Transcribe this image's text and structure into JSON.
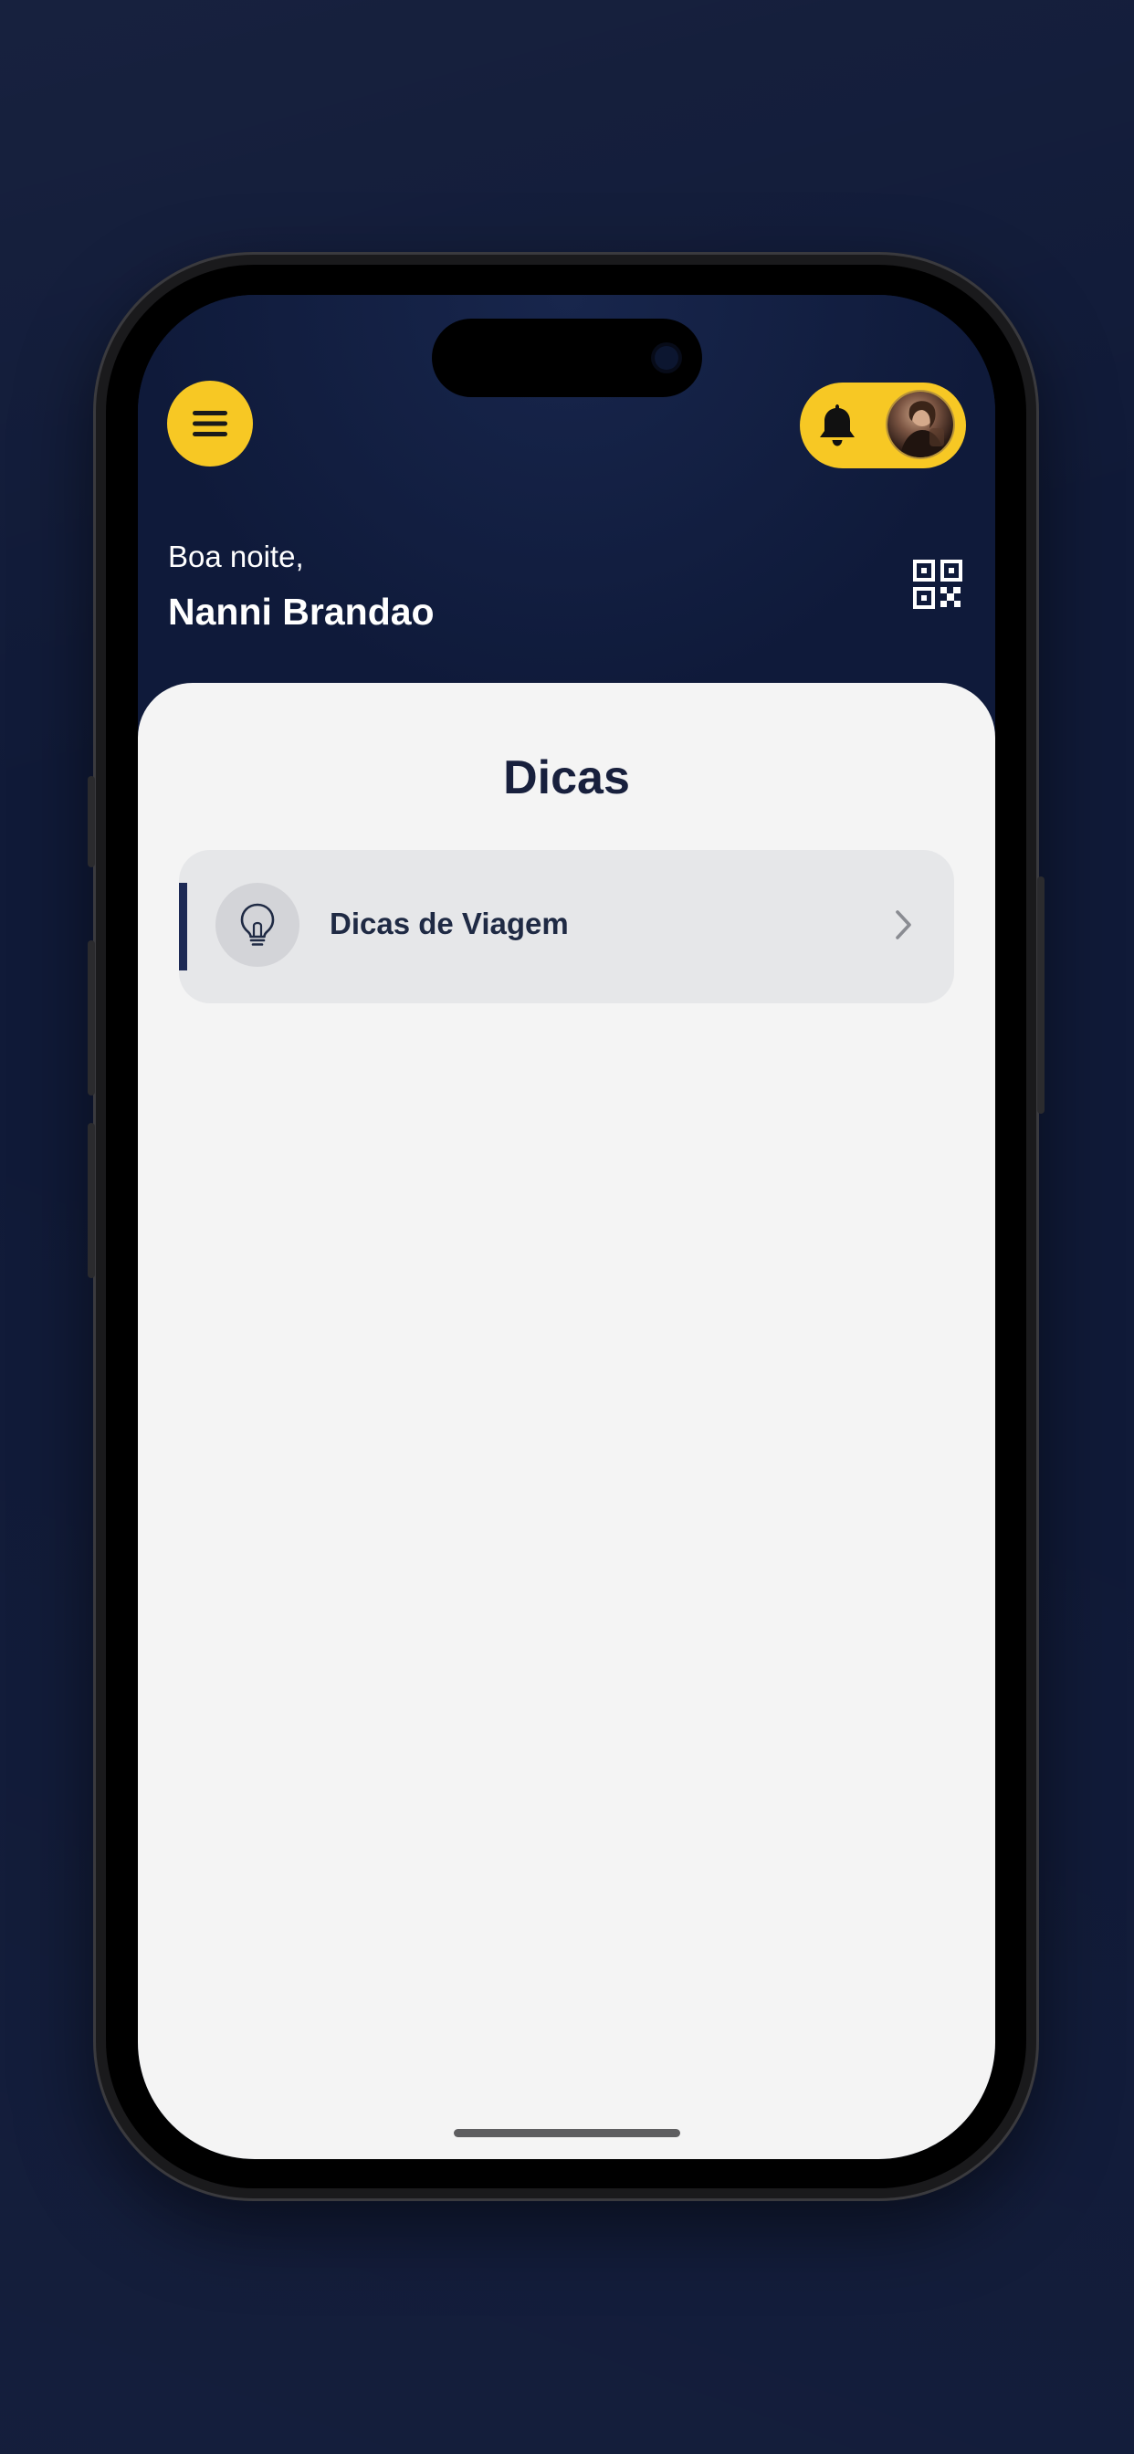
{
  "header": {
    "greeting": "Boa noite,",
    "user_name": "Nanni Brandao"
  },
  "icons": {
    "menu": "hamburger-menu-icon",
    "bell": "bell-icon",
    "avatar": "user-avatar",
    "qr": "qr-code-icon",
    "tip": "lightbulb-icon",
    "chevron": "chevron-right-icon"
  },
  "main": {
    "title": "Dicas",
    "items": [
      {
        "label": "Dicas de Viagem"
      }
    ]
  },
  "colors": {
    "accent": "#f7c824",
    "navy": "#0f1a3a",
    "sheet": "#f4f4f4",
    "card": "#e6e7e9"
  }
}
